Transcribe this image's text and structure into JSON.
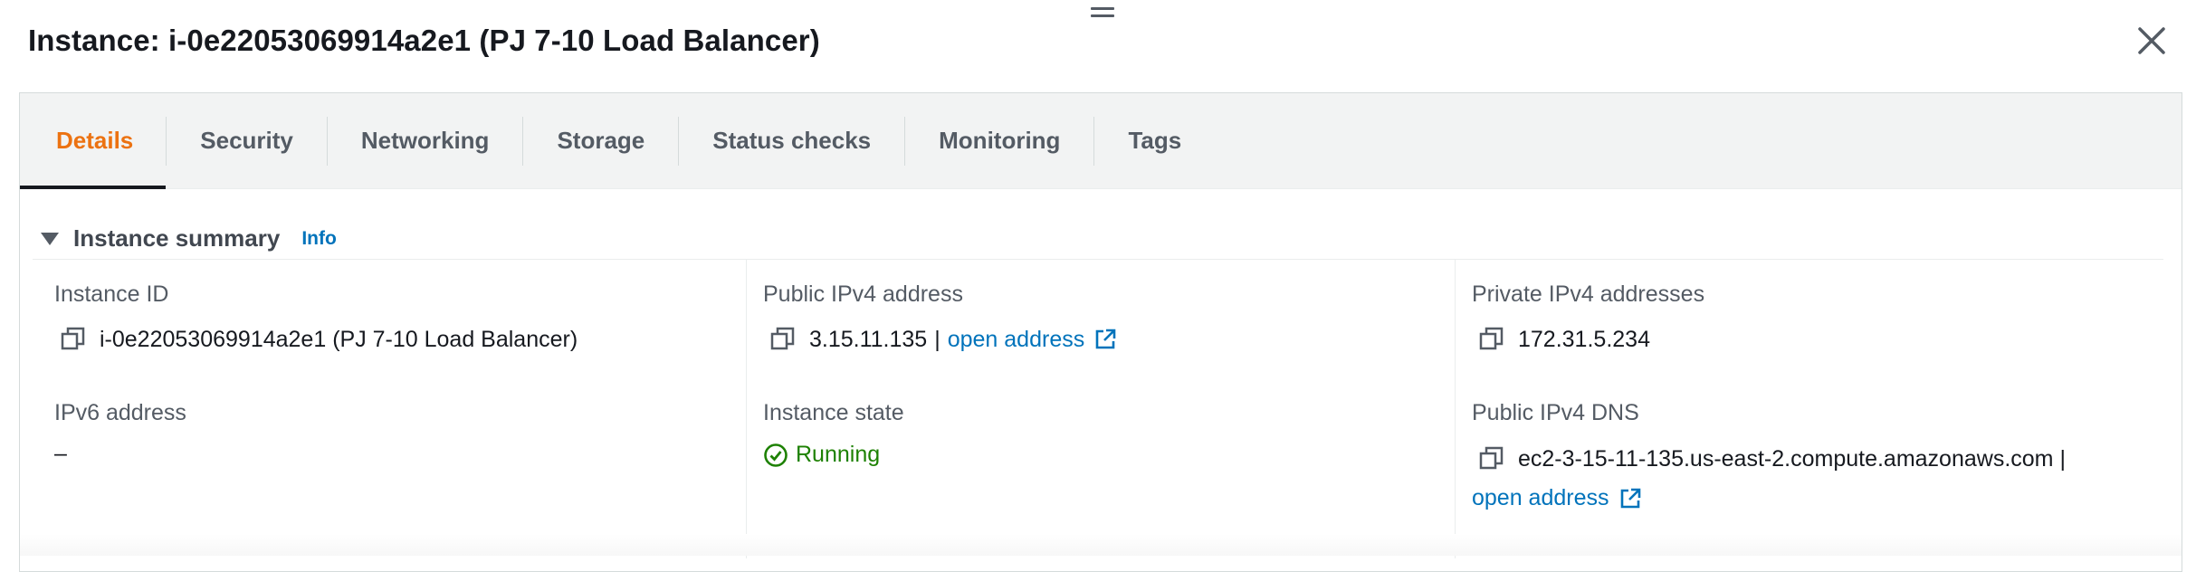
{
  "header": {
    "title": "Instance: i-0e22053069914a2e1 (PJ 7-10 Load Balancer)",
    "close_icon": "close-icon",
    "drag_icon": "drag-handle-icon"
  },
  "tabs": [
    {
      "label": "Details",
      "active": true
    },
    {
      "label": "Security"
    },
    {
      "label": "Networking"
    },
    {
      "label": "Storage"
    },
    {
      "label": "Status checks"
    },
    {
      "label": "Monitoring"
    },
    {
      "label": "Tags"
    }
  ],
  "summary": {
    "title": "Instance summary",
    "info": "Info",
    "instance_id": {
      "label": "Instance ID",
      "value": "i-0e22053069914a2e1 (PJ 7-10 Load Balancer)"
    },
    "public_ipv4": {
      "label": "Public IPv4 address",
      "value": "3.15.11.135",
      "sep": "|",
      "link": "open address"
    },
    "private_ipv4": {
      "label": "Private IPv4 addresses",
      "value": "172.31.5.234"
    },
    "ipv6": {
      "label": "IPv6 address",
      "value": "–"
    },
    "instance_state": {
      "label": "Instance state",
      "value": "Running"
    },
    "public_dns": {
      "label": "Public IPv4 DNS",
      "value": "ec2-3-15-11-135.us-east-2.compute.amazonaws.com |",
      "link": "open address"
    }
  },
  "colors": {
    "accent": "#ec7211",
    "link": "#0073bb",
    "success": "#1d8102"
  }
}
